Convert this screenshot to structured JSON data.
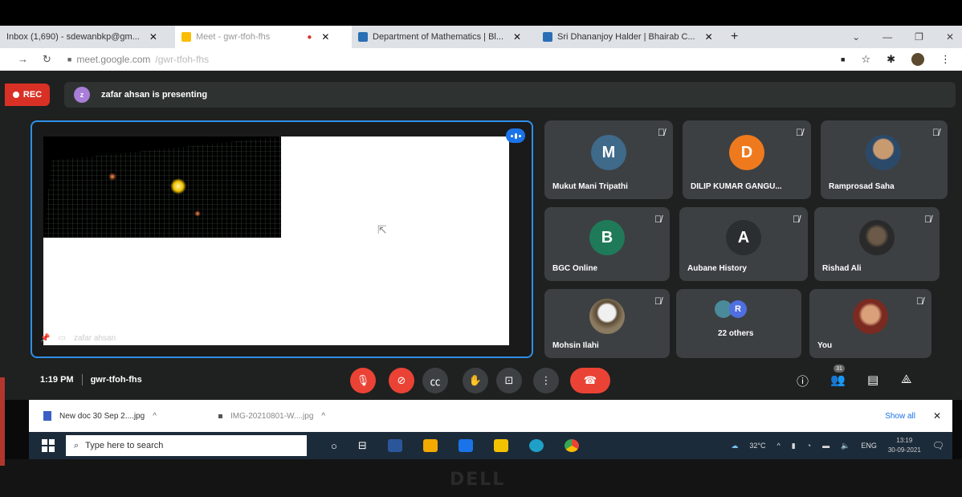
{
  "browser": {
    "tabs": [
      {
        "title": "Inbox (1,690) - sdewanbkp@gm...",
        "active": false
      },
      {
        "title": "Meet - gwr-tfoh-fhs",
        "active": true
      },
      {
        "title": "Department of Mathematics | Bl...",
        "active": false
      },
      {
        "title": "Sri Dhananjoy Halder | Bhairab C...",
        "active": false
      }
    ],
    "new_tab": "+",
    "url_host": "meet.google.com",
    "url_path": "/gwr-tfoh-fhs"
  },
  "meet": {
    "rec_label": "REC",
    "presenter_initial": "z",
    "presenting_text": "zafar ahsan is presenting",
    "presenter_footer": "zafar ahsan",
    "time": "1:19 PM",
    "meeting_code": "gwr-tfoh-fhs",
    "people_count": "31",
    "participants": [
      {
        "name": "Mukut Mani Tripathi",
        "initial": "M",
        "color": "#3f6a8a"
      },
      {
        "name": "DILIP KUMAR GANGU...",
        "initial": "D",
        "color": "#ef7a1d"
      },
      {
        "name": "Ramprosad Saha",
        "initial": "",
        "color": ""
      },
      {
        "name": "BGC Online",
        "initial": "B",
        "color": "#1f7a5a"
      },
      {
        "name": "Aubane History",
        "initial": "A",
        "color": "#3c4043"
      },
      {
        "name": "Rishad Ali",
        "initial": "",
        "color": ""
      },
      {
        "name": "Mohsin Ilahi",
        "initial": "",
        "color": ""
      },
      {
        "name": "22 others",
        "initial": "R",
        "color": "#4f6fe0"
      },
      {
        "name": "You",
        "initial": "",
        "color": ""
      }
    ]
  },
  "downloads": {
    "items": [
      "New doc 30 Sep 2....jpg",
      "IMG-20210801-W....jpg"
    ],
    "show_all": "Show all"
  },
  "taskbar": {
    "search_placeholder": "Type here to search",
    "weather": "32°C",
    "lang": "ENG",
    "clock_time": "13:19",
    "clock_date": "30-09-2021"
  },
  "brand": "DELL"
}
